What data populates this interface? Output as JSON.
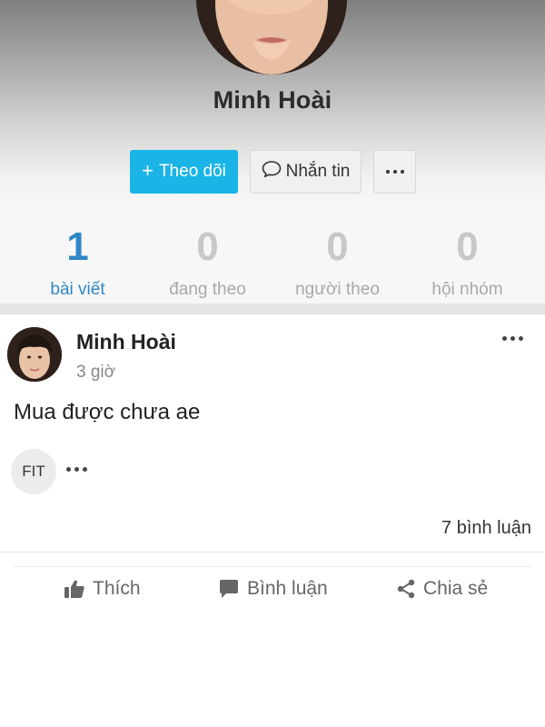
{
  "profile": {
    "name": "Minh Hoài",
    "follow_label": "Theo dõi",
    "follow_icon": "plus-icon",
    "message_label": "Nhắn tin",
    "message_icon": "chat-bubble-icon",
    "more_icon": "more-dots-icon"
  },
  "stats": [
    {
      "value": "1",
      "label": "bài viết",
      "active": true
    },
    {
      "value": "0",
      "label": "đang theo",
      "active": false
    },
    {
      "value": "0",
      "label": "người theo",
      "active": false
    },
    {
      "value": "0",
      "label": "hội nhóm",
      "active": false
    }
  ],
  "post": {
    "author": "Minh Hoài",
    "time": "3 giờ",
    "text": "Mua được chưa ae",
    "group_badge": "FIT",
    "comment_count_text": "7 bình luận",
    "actions": {
      "like_label": "Thích",
      "comment_label": "Bình luận",
      "share_label": "Chia sẻ"
    }
  },
  "colors": {
    "accent": "#1ab4e6",
    "active_stat": "#2f87c7",
    "inactive_stat": "#c8c8c8"
  }
}
